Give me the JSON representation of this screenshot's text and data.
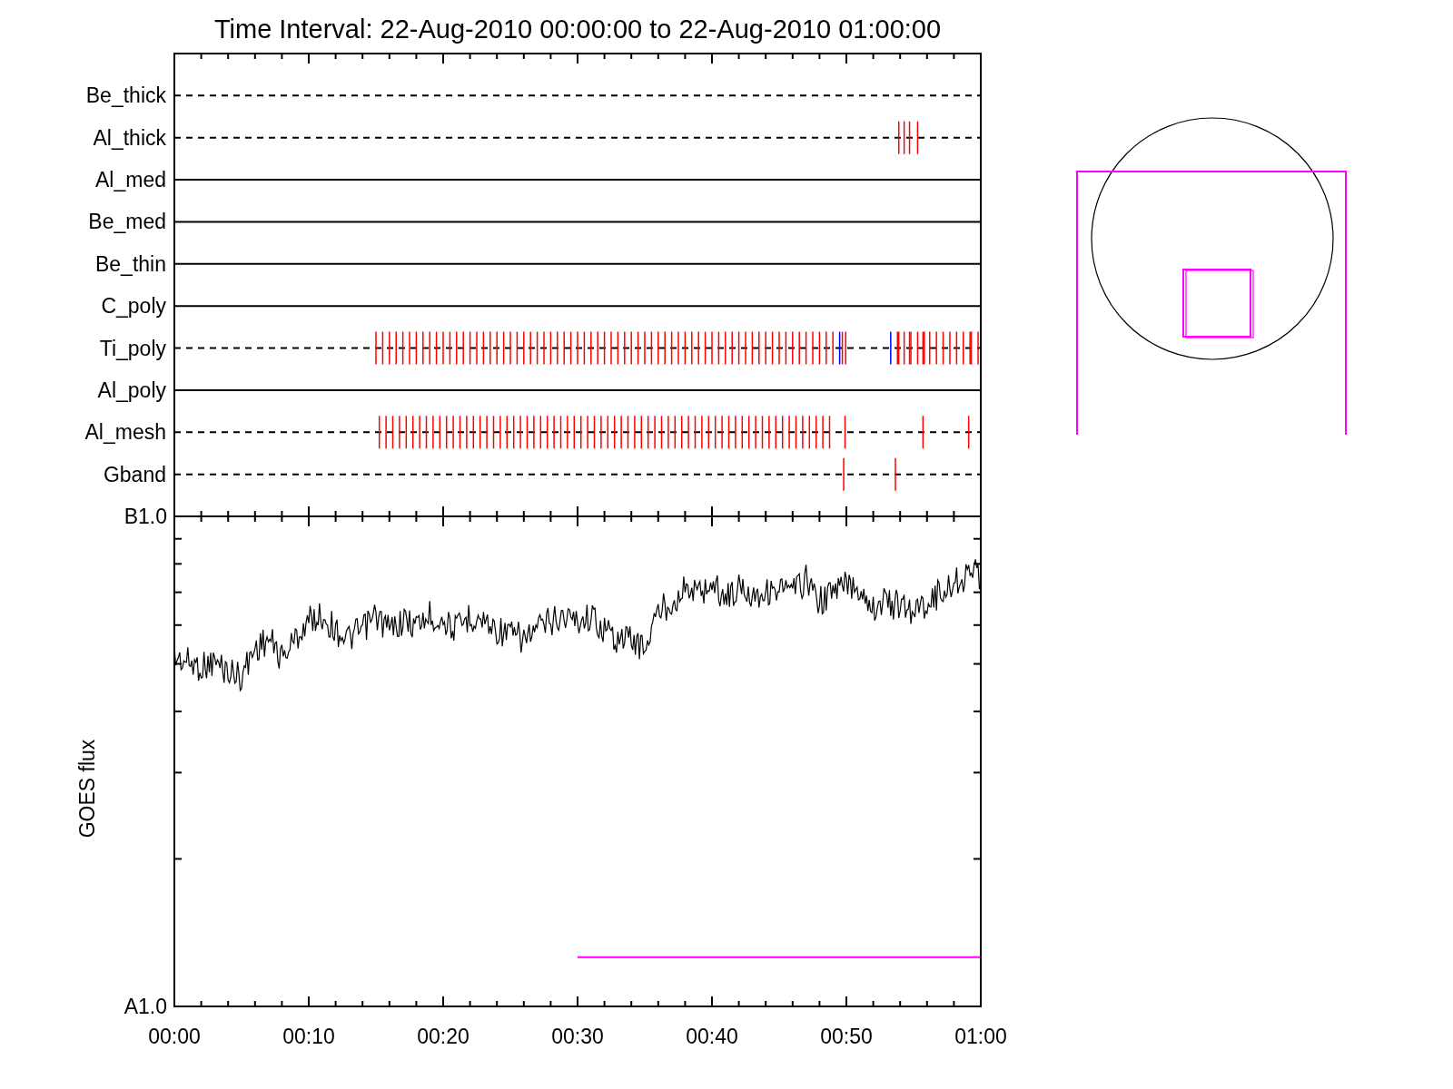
{
  "title": "Time Interval: 22-Aug-2010 00:00:00 to 22-Aug-2010 01:00:00",
  "filter_panel": {
    "rows": [
      {
        "label": "Be_thick",
        "kind": "dashed"
      },
      {
        "label": "Al_thick",
        "kind": "dashed"
      },
      {
        "label": "Al_med",
        "kind": "solid"
      },
      {
        "label": "Be_med",
        "kind": "solid"
      },
      {
        "label": "Be_thin",
        "kind": "solid"
      },
      {
        "label": "C_poly",
        "kind": "solid"
      },
      {
        "label": "Ti_poly",
        "kind": "dashed"
      },
      {
        "label": "Al_poly",
        "kind": "solid"
      },
      {
        "label": "Al_mesh",
        "kind": "dashed"
      },
      {
        "label": "Gband",
        "kind": "dashed"
      }
    ]
  },
  "flux_panel": {
    "y_axis_title": "GOES flux",
    "y_labels": [
      "B1.0",
      "A1.0"
    ],
    "x_labels": [
      "00:00",
      "00:10",
      "00:20",
      "00:30",
      "00:40",
      "00:50",
      "01:00"
    ]
  }
}
